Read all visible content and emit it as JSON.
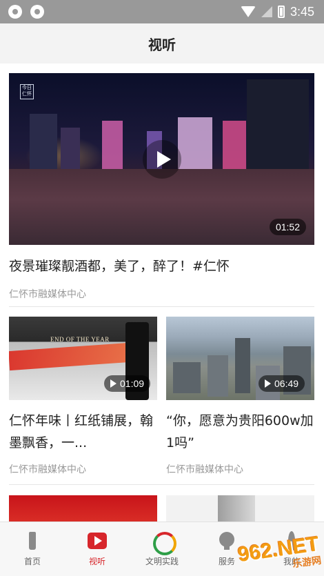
{
  "status_bar": {
    "time": "3:45"
  },
  "header": {
    "title": "视听"
  },
  "feed": {
    "featured": {
      "title": "夜景璀璨靓酒都，美了，醉了！#仁怀",
      "source": "仁怀市融媒体中心",
      "duration": "01:52",
      "badge_text": "今日仁怀"
    },
    "grid": [
      {
        "title": "仁怀年味丨红纸铺展，翰墨飘香，一...",
        "source": "仁怀市融媒体中心",
        "duration": "01:09",
        "overlay_text": "END OF THE YEAR"
      },
      {
        "title": "“你，愿意为贵阳600w加1吗”",
        "source": "仁怀市融媒体中心",
        "duration": "06:49"
      }
    ]
  },
  "tabbar": {
    "items": [
      {
        "label": "首页",
        "icon": "home-icon"
      },
      {
        "label": "视听",
        "icon": "video-play-icon"
      },
      {
        "label": "文明实践",
        "icon": "civilization-logo-icon"
      },
      {
        "label": "服务",
        "icon": "service-icon"
      },
      {
        "label": "我的",
        "icon": "mine-icon"
      }
    ],
    "active_color": "#d7262b"
  },
  "watermark": {
    "main": "962.NET",
    "sub": "乐游网"
  }
}
